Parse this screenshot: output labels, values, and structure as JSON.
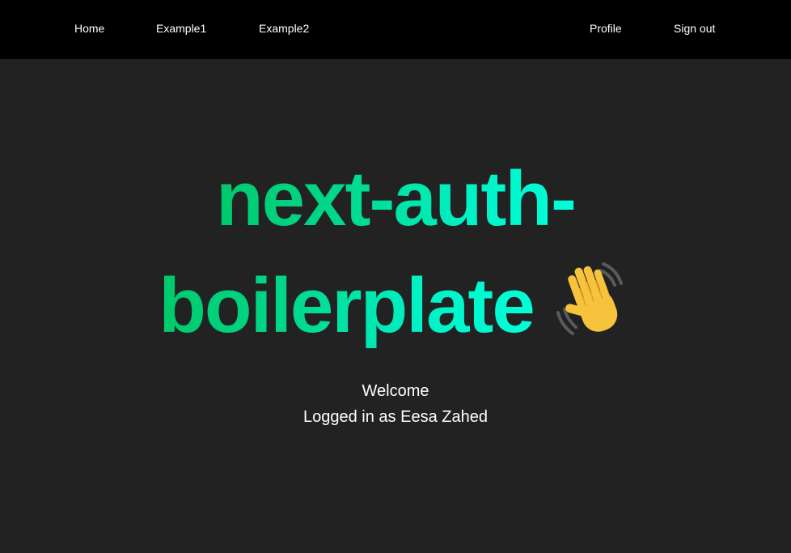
{
  "nav": {
    "left_links": [
      "Home",
      "Example1",
      "Example2"
    ],
    "right_links": [
      "Profile",
      "Sign out"
    ]
  },
  "hero": {
    "line1": "next-auth-",
    "line2": "boilerplate",
    "emoji_icon": "waving-hand-icon",
    "gradient_start": "#00c96b",
    "gradient_end": "#00ffd9"
  },
  "welcome": {
    "heading": "Welcome",
    "status": "Logged in as Eesa Zahed"
  },
  "colors": {
    "background": "#222222",
    "navbar": "#000000",
    "text": "#ffffff"
  }
}
